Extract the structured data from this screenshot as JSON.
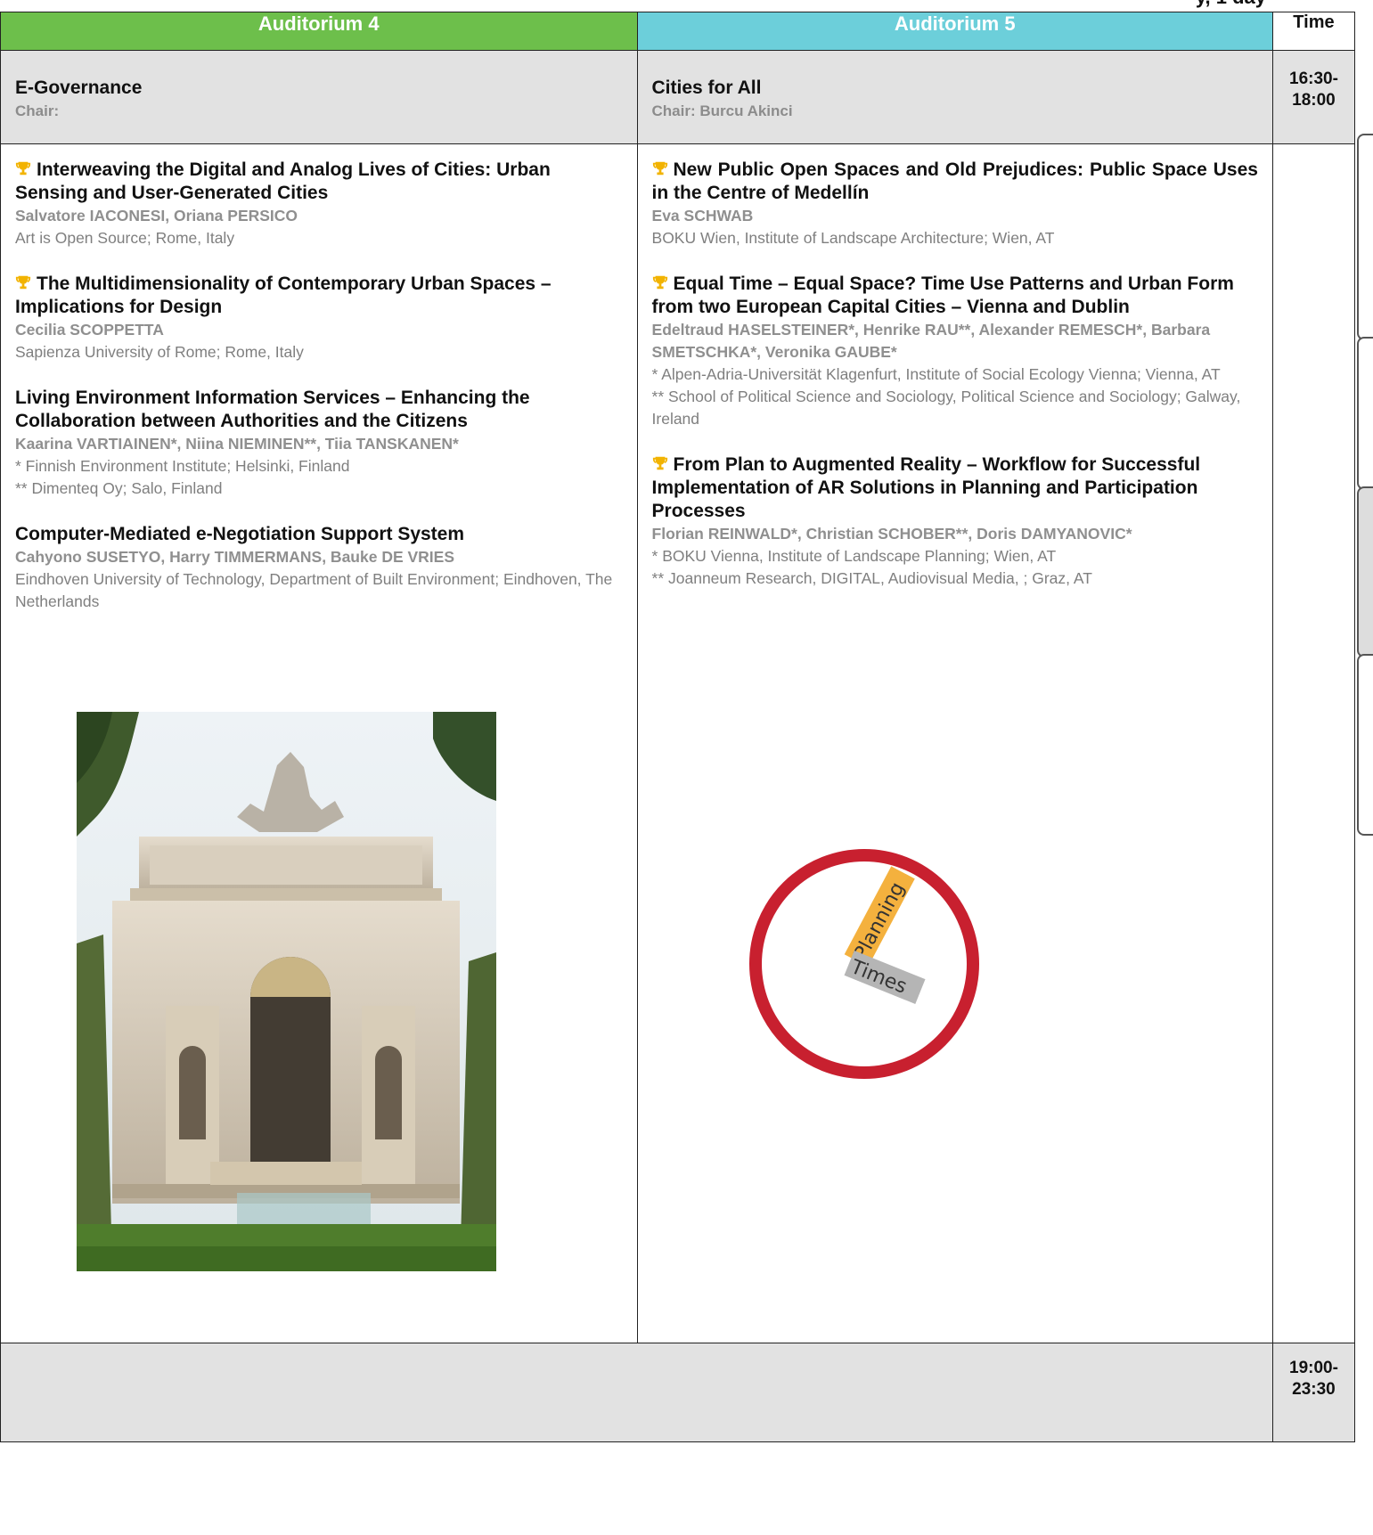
{
  "header_cut": "y, 1 day",
  "columns": {
    "auditorium4": "Auditorium 4",
    "auditorium5": "Auditorium 5",
    "time": "Time"
  },
  "session": {
    "left": {
      "title": "E-Governance",
      "chair": "Chair:"
    },
    "right": {
      "title": "Cities for All",
      "chair": "Chair: Burcu Akinci"
    },
    "time_start": "16:30-",
    "time_end": "18:00"
  },
  "papers_left": [
    {
      "title": "Interweaving the Digital and Analog Lives of Cities: Urban Sensing and User-Generated Cities",
      "authors": "Salvatore IACONESI, Oriana PERSICO",
      "affiliations": [
        "Art is Open Source; Rome, Italy"
      ]
    },
    {
      "title": "The Multidimensionality of Contemporary Urban Spaces – Implications for Design",
      "authors": "Cecilia SCOPPETTA",
      "affiliations": [
        "Sapienza University of Rome; Rome, Italy"
      ]
    },
    {
      "title": "Living Environment Information Services – Enhancing the Collaboration between Authorities and the Citizens",
      "authors": "Kaarina VARTIAINEN*, Niina NIEMINEN**, Tiia TANSKANEN*",
      "affiliations": [
        "* Finnish Environment Institute; Helsinki, Finland",
        "** Dimenteq Oy; Salo, Finland"
      ]
    },
    {
      "title": "Computer-Mediated e-Negotiation Support System",
      "authors": "Cahyono SUSETYO, Harry TIMMERMANS, Bauke DE VRIES",
      "affiliations": [
        "Eindhoven University of Technology, Department of Built Environment; Eindhoven, The Netherlands"
      ]
    }
  ],
  "papers_right": [
    {
      "title": "New Public Open Spaces and Old Prejudices: Public Space Uses in the Centre of Medellín",
      "authors": "Eva SCHWAB",
      "affiliations": [
        "BOKU Wien, Institute of Landscape Architecture; Wien, AT"
      ]
    },
    {
      "title": "Equal Time – Equal Space? Time Use Patterns and Urban Form from two European Capital Cities – Vienna and Dublin",
      "authors": "Edeltraud HASELSTEINER*, Henrike RAU**, Alexander REMESCH*, Barbara SMETSCHKA*, Veronika GAUBE*",
      "affiliations": [
        "* Alpen-Adria-Universität Klagenfurt, Institute of Social Ecology Vienna; Vienna, AT",
        "** School of Political Science and Sociology, Political Science and Sociology; Galway, Ireland"
      ]
    },
    {
      "title": "From Plan to Augmented Reality – Workflow for Successful Implementation of AR Solutions in Planning and Participation Processes",
      "authors": "Florian REINWALD*, Christian SCHOBER**, Doris DAMYANOVIC*",
      "affiliations": [
        "* BOKU Vienna, Institute of Landscape Planning; Wien, AT",
        "** Joanneum Research, DIGITAL, Audiovisual Media, ; Graz, AT"
      ]
    }
  ],
  "logo": {
    "word1": "Planning",
    "word2": "Times"
  },
  "evening": {
    "time_start": "19:00-",
    "time_end": "23:30"
  },
  "colors": {
    "auditorium4": "#6dbf4b",
    "auditorium5": "#6ccfda",
    "session_bg": "#e2e2e2",
    "trophy": "#f2b300",
    "logo_ring": "#c8202f"
  }
}
